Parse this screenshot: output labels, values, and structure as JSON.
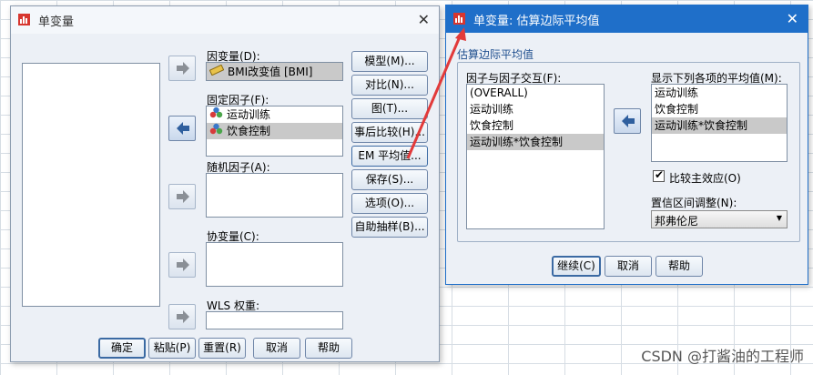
{
  "left_dialog": {
    "title": "单变量",
    "dependent_label": "因变量(D):",
    "dependent_value": "BMI改变值 [BMI]",
    "fixed_label": "固定因子(F):",
    "fixed_items": [
      "运动训练",
      "饮食控制"
    ],
    "random_label": "随机因子(A):",
    "covariate_label": "协变量(C):",
    "wls_label": "WLS 权重:",
    "side_buttons": [
      "模型(M)...",
      "对比(N)...",
      "图(T)...",
      "事后比较(H)...",
      "EM 平均值...",
      "保存(S)...",
      "选项(O)...",
      "自助抽样(B)..."
    ],
    "bottom_buttons": [
      "确定",
      "粘贴(P)",
      "重置(R)",
      "取消",
      "帮助"
    ]
  },
  "right_dialog": {
    "title": "单变量: 估算边际平均值",
    "group_label": "估算边际平均值",
    "factors_label": "因子与因子交互(F):",
    "factors": [
      "(OVERALL)",
      "运动训练",
      "饮食控制",
      "运动训练*饮食控制"
    ],
    "display_label": "显示下列各项的平均值(M):",
    "display_items": [
      "运动训练",
      "饮食控制",
      "运动训练*饮食控制"
    ],
    "compare_checkbox_label": "比较主效应(O)",
    "compare_checked": true,
    "ci_label": "置信区间调整(N):",
    "ci_value": "邦弗伦尼",
    "buttons": [
      "继续(C)",
      "取消",
      "帮助"
    ]
  },
  "watermark": "CSDN @打酱油的工程师",
  "colors": {
    "annotation_arrow": "#e23a3a",
    "active_titlebar": "#1f6fc9",
    "selection": "#c9c9c9"
  }
}
